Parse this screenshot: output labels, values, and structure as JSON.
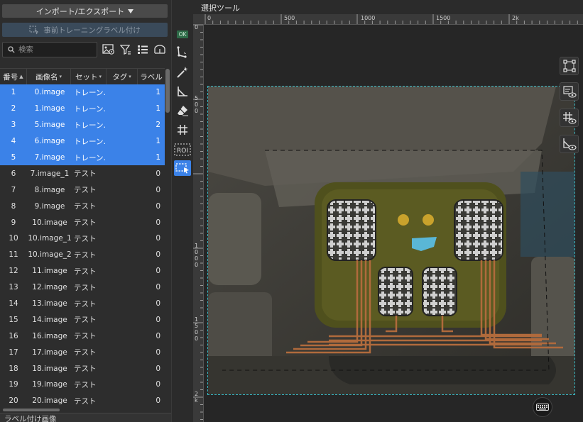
{
  "left_panel": {
    "import_export_label": "インポート/エクスポート",
    "pretrain_label": "事前トレーニングラベル付け",
    "search_placeholder": "検索",
    "bottom_header": "ラベル付け画像"
  },
  "table": {
    "headers": {
      "no": "番号",
      "name": "画像名",
      "set": "セット",
      "tag": "タグ",
      "label": "ラベル"
    },
    "rows": [
      {
        "no": "1",
        "name": "0.image",
        "set": "トレーン…",
        "label": "1",
        "selected": true
      },
      {
        "no": "2",
        "name": "1.image",
        "set": "トレーン…",
        "label": "1",
        "selected": true
      },
      {
        "no": "3",
        "name": "5.image",
        "set": "トレーン…",
        "label": "2",
        "selected": true
      },
      {
        "no": "4",
        "name": "6.image",
        "set": "トレーン…",
        "label": "1",
        "selected": true
      },
      {
        "no": "5",
        "name": "7.image",
        "set": "トレーン…",
        "label": "1",
        "selected": true
      },
      {
        "no": "6",
        "name": "7.image_1",
        "set": "テスト",
        "label": "0",
        "selected": false
      },
      {
        "no": "7",
        "name": "8.image",
        "set": "テスト",
        "label": "0",
        "selected": false
      },
      {
        "no": "8",
        "name": "9.image",
        "set": "テスト",
        "label": "0",
        "selected": false
      },
      {
        "no": "9",
        "name": "10.image",
        "set": "テスト",
        "label": "0",
        "selected": false
      },
      {
        "no": "10",
        "name": "10.image_1",
        "set": "テスト",
        "label": "0",
        "selected": false
      },
      {
        "no": "11",
        "name": "10.image_2",
        "set": "テスト",
        "label": "0",
        "selected": false
      },
      {
        "no": "12",
        "name": "11.image",
        "set": "テスト",
        "label": "0",
        "selected": false
      },
      {
        "no": "13",
        "name": "12.image",
        "set": "テスト",
        "label": "0",
        "selected": false
      },
      {
        "no": "14",
        "name": "13.image",
        "set": "テスト",
        "label": "0",
        "selected": false
      },
      {
        "no": "15",
        "name": "14.image",
        "set": "テスト",
        "label": "0",
        "selected": false
      },
      {
        "no": "16",
        "name": "16.image",
        "set": "テスト",
        "label": "0",
        "selected": false
      },
      {
        "no": "17",
        "name": "17.image",
        "set": "テスト",
        "label": "0",
        "selected": false
      },
      {
        "no": "18",
        "name": "18.image",
        "set": "テスト",
        "label": "0",
        "selected": false
      },
      {
        "no": "19",
        "name": "19.image",
        "set": "テスト",
        "label": "0",
        "selected": false
      },
      {
        "no": "20",
        "name": "20.image",
        "set": "テスト",
        "label": "0",
        "selected": false
      }
    ]
  },
  "tools": {
    "ok_badge": "OK",
    "roi_label": "ROI",
    "items": [
      "ok-badge",
      "polygon-lasso-icon",
      "magic-wand-icon",
      "angle-ruler-icon",
      "eraser-icon",
      "grid-icon",
      "roi-icon",
      "select-box-icon"
    ]
  },
  "canvas": {
    "title": "選択ツール",
    "ruler_top_labels": [
      "0",
      "500",
      "1000",
      "1500",
      "2k"
    ],
    "ruler_left_labels": [
      "0",
      "5",
      "0",
      "0",
      "1",
      "0",
      "0",
      "0",
      "1",
      "5",
      "0",
      "0",
      "2",
      "k"
    ]
  },
  "colors": {
    "selection": "#3b82e8",
    "frame": "#38b9c4",
    "ok_badge": "#2e6b48"
  }
}
